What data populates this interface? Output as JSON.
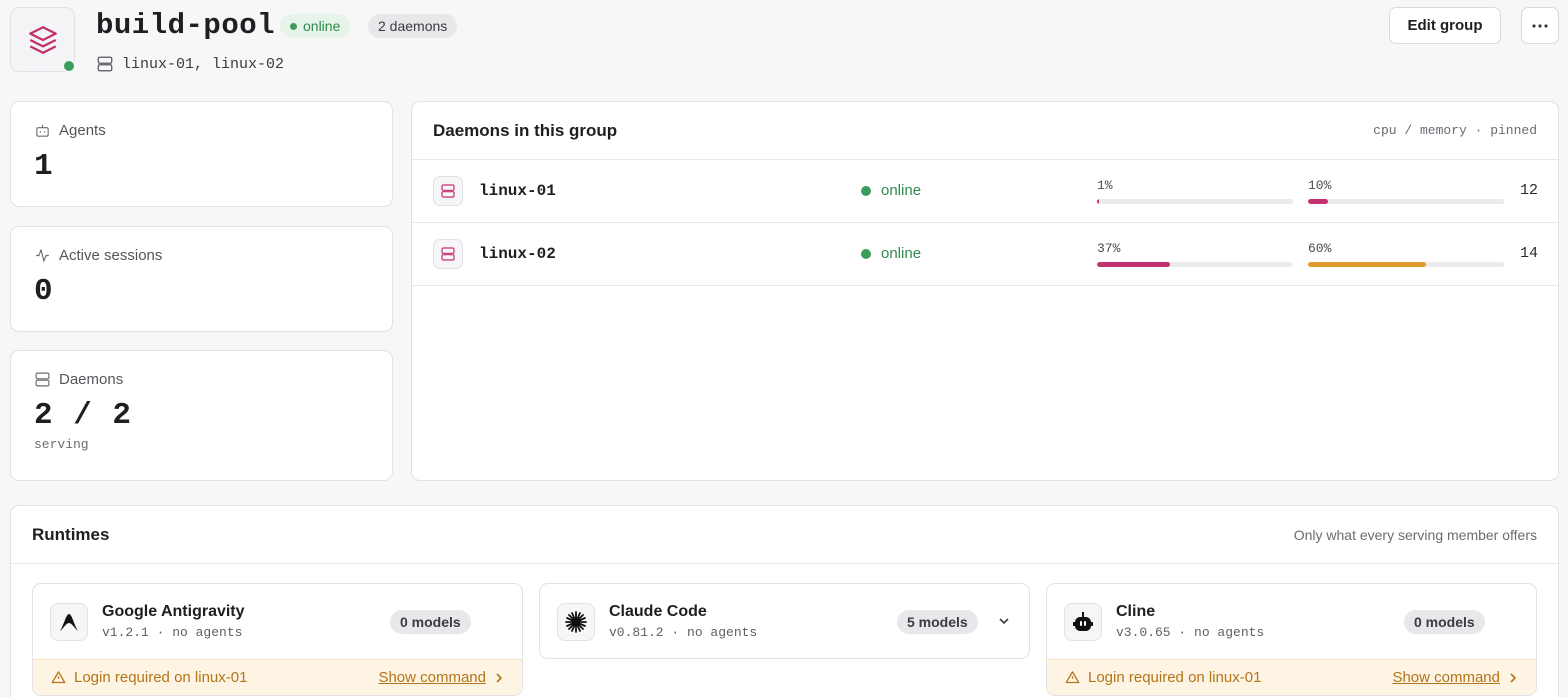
{
  "header": {
    "title": "build-pool",
    "status": "online",
    "daemon_count": "2 daemons",
    "members": "linux-01, linux-02",
    "edit_label": "Edit group",
    "icon": "layers-icon"
  },
  "stats": [
    {
      "label": "Agents",
      "value": "1",
      "icon": "bot-icon"
    },
    {
      "label": "Active sessions",
      "value": "0",
      "icon": "activity-icon"
    },
    {
      "label": "Daemons",
      "value": "2 / 2",
      "sub": "serving",
      "icon": "server-icon"
    }
  ],
  "daemons": {
    "title": "Daemons in this group",
    "hint": "cpu / memory · pinned",
    "rows": [
      {
        "name": "linux-01",
        "status": "online",
        "cpu": 1,
        "cpu_label": "1%",
        "mem": 10,
        "mem_label": "10%",
        "pinned": "12"
      },
      {
        "name": "linux-02",
        "status": "online",
        "cpu": 37,
        "cpu_label": "37%",
        "mem": 60,
        "mem_label": "60%",
        "pinned": "14"
      }
    ]
  },
  "runtimes": {
    "title": "Runtimes",
    "hint": "Only what every serving member offers",
    "items": [
      {
        "name": "Google Antigravity",
        "meta": "v1.2.1 · no agents",
        "models": "0 models",
        "icon": "antigravity-icon",
        "warning": "Login required on linux-01",
        "action": "Show command"
      },
      {
        "name": "Claude Code",
        "meta": "v0.81.2 · no agents",
        "models": "5 models",
        "icon": "claude-burst-icon"
      },
      {
        "name": "Cline",
        "meta": "v3.0.65 · no agents",
        "models": "0 models",
        "icon": "cline-robot-icon",
        "warning": "Login required on linux-01",
        "action": "Show command"
      }
    ]
  },
  "colors": {
    "accent": "#c2306f",
    "online": "#3c9d5b",
    "warning": "#b4741a",
    "memory_high": "#de9a2c"
  }
}
